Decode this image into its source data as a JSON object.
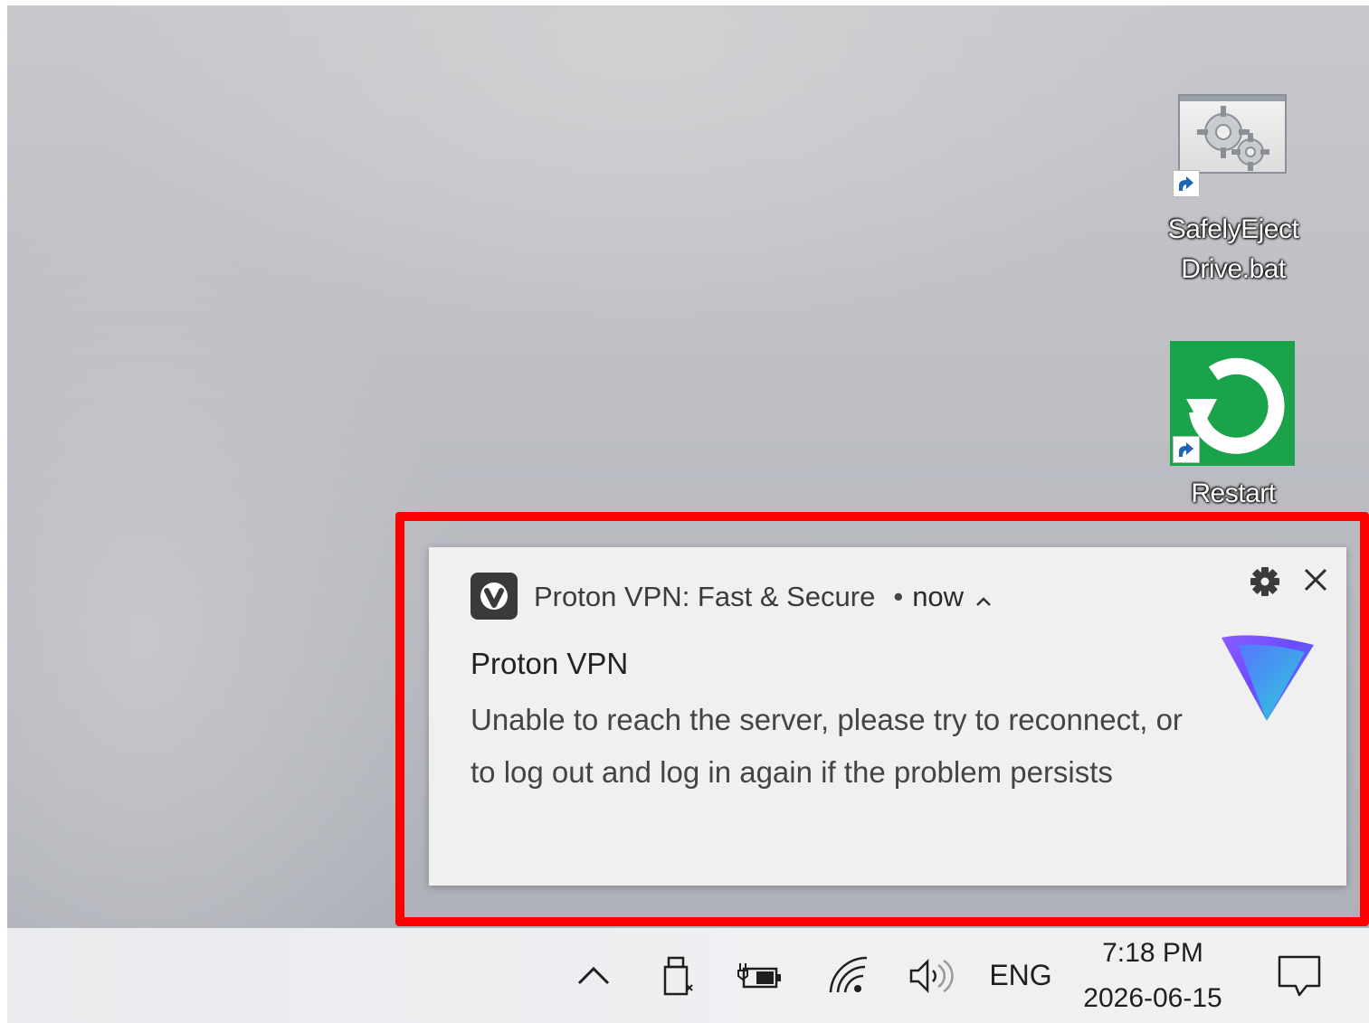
{
  "desktop": {
    "icons": [
      {
        "label_line1": "SafelyEject",
        "label_line2": "Drive.bat",
        "icon": "gears-window-icon"
      },
      {
        "label_line1": "Restart",
        "icon": "restart-icon"
      }
    ]
  },
  "toast": {
    "app_name": "Proton VPN: Fast & Secure",
    "separator": "•",
    "time": "now",
    "title": "Proton VPN",
    "body": "Unable to reach the server, please try to reconnect, or to log out and log in again if the problem persists",
    "highlight_color": "#ff0000",
    "brand_colors": [
      "#6d4aff",
      "#28c3e0"
    ]
  },
  "taskbar": {
    "language": "ENG",
    "time": "7:18 PM",
    "date": "2026-06-15"
  }
}
